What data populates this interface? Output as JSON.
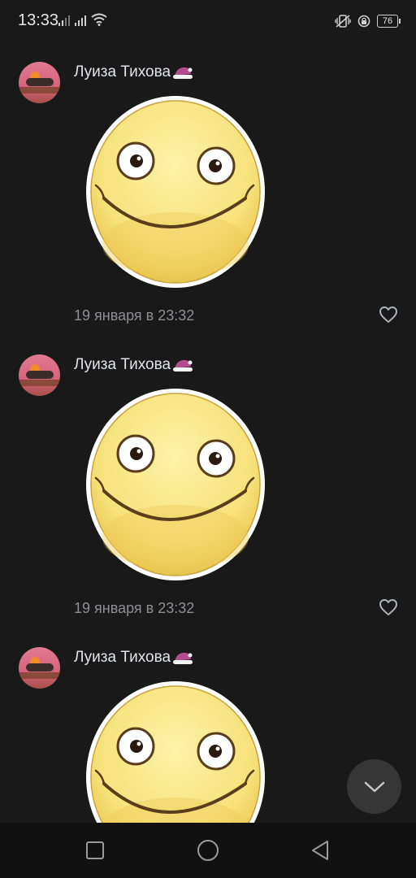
{
  "status_bar": {
    "time": "13:33",
    "battery_level": "76",
    "icons": [
      "signal-icon",
      "signal-icon",
      "wifi-icon",
      "vibrate-icon",
      "alarm-icon",
      "battery-icon"
    ]
  },
  "messages": [
    {
      "author": "Луиза Тихова",
      "timestamp": "19 января в 23:32",
      "sticker": "smiley-face-sticker"
    },
    {
      "author": "Луиза Тихова",
      "timestamp": "19 января в 23:32",
      "sticker": "smiley-face-sticker"
    },
    {
      "author": "Луиза Тихова",
      "timestamp": "",
      "sticker": "smiley-face-sticker"
    }
  ],
  "scroll_down_button": {
    "icon": "chevron-down-icon"
  },
  "nav_bar": {
    "buttons": [
      "recents-square-icon",
      "home-circle-icon",
      "back-triangle-icon"
    ]
  },
  "colors": {
    "background": "#191919",
    "text_primary": "#e1e3e6",
    "text_secondary": "#8e8e93",
    "sticker_face": "#f7e27c",
    "scroll_button": "#363636"
  }
}
